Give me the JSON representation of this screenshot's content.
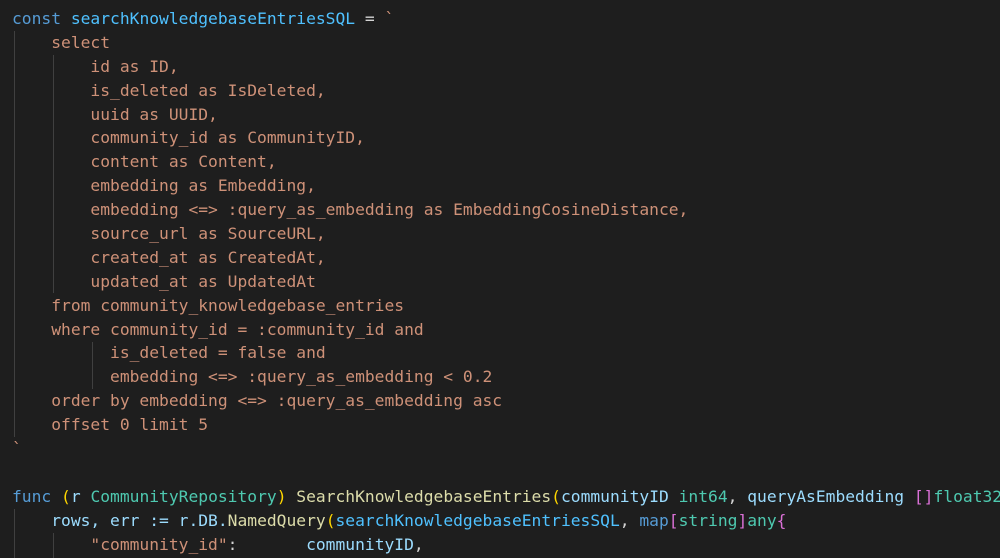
{
  "editor": {
    "code_lines": [
      [
        {
          "text": "const ",
          "cls": "kw"
        },
        {
          "text": "searchKnowledgebaseEntriesSQL",
          "cls": "ct"
        },
        {
          "text": " = ",
          "cls": "op"
        },
        {
          "text": "`",
          "cls": "str"
        }
      ],
      [
        {
          "text": "    select",
          "cls": "str"
        }
      ],
      [
        {
          "text": "        id as ID,",
          "cls": "str"
        }
      ],
      [
        {
          "text": "        is_deleted as IsDeleted,",
          "cls": "str"
        }
      ],
      [
        {
          "text": "        uuid as UUID,",
          "cls": "str"
        }
      ],
      [
        {
          "text": "        community_id as CommunityID,",
          "cls": "str"
        }
      ],
      [
        {
          "text": "        content as Content,",
          "cls": "str"
        }
      ],
      [
        {
          "text": "        embedding as Embedding,",
          "cls": "str"
        }
      ],
      [
        {
          "text": "        embedding <=> :query_as_embedding as EmbeddingCosineDistance,",
          "cls": "str"
        }
      ],
      [
        {
          "text": "        source_url as SourceURL,",
          "cls": "str"
        }
      ],
      [
        {
          "text": "        created_at as CreatedAt,",
          "cls": "str"
        }
      ],
      [
        {
          "text": "        updated_at as UpdatedAt",
          "cls": "str"
        }
      ],
      [
        {
          "text": "    from community_knowledgebase_entries",
          "cls": "str"
        }
      ],
      [
        {
          "text": "    where community_id = :community_id and",
          "cls": "str"
        }
      ],
      [
        {
          "text": "          is_deleted = false and",
          "cls": "str"
        }
      ],
      [
        {
          "text": "          embedding <=> :query_as_embedding < 0.2",
          "cls": "str"
        }
      ],
      [
        {
          "text": "    order by embedding <=> :query_as_embedding asc",
          "cls": "str"
        }
      ],
      [
        {
          "text": "    offset 0 limit 5",
          "cls": "str"
        }
      ],
      [
        {
          "text": "`",
          "cls": "str"
        }
      ],
      [
        {
          "text": "",
          "cls": "op"
        }
      ],
      [
        {
          "text": "func ",
          "cls": "kw"
        },
        {
          "text": "(",
          "cls": "br1"
        },
        {
          "text": "r ",
          "cls": "pm"
        },
        {
          "text": "CommunityRepository",
          "cls": "tp"
        },
        {
          "text": ") ",
          "cls": "br1"
        },
        {
          "text": "SearchKnowledgebaseEntries",
          "cls": "fn"
        },
        {
          "text": "(",
          "cls": "br1"
        },
        {
          "text": "communityID ",
          "cls": "pm"
        },
        {
          "text": "int64",
          "cls": "tp"
        },
        {
          "text": ", ",
          "cls": "op"
        },
        {
          "text": "queryAsEmbedding ",
          "cls": "pm"
        },
        {
          "text": "[]",
          "cls": "br2"
        },
        {
          "text": "float32",
          "cls": "tp"
        },
        {
          "text": ")",
          "cls": "br1"
        }
      ],
      [
        {
          "text": "    rows, err := ",
          "cls": "pm"
        },
        {
          "text": "r.DB.",
          "cls": "pm"
        },
        {
          "text": "NamedQuery",
          "cls": "fn"
        },
        {
          "text": "(",
          "cls": "br1"
        },
        {
          "text": "searchKnowledgebaseEntriesSQL",
          "cls": "ct"
        },
        {
          "text": ", ",
          "cls": "op"
        },
        {
          "text": "map",
          "cls": "kw"
        },
        {
          "text": "[",
          "cls": "br2"
        },
        {
          "text": "string",
          "cls": "tp"
        },
        {
          "text": "]",
          "cls": "br2"
        },
        {
          "text": "any",
          "cls": "tp"
        },
        {
          "text": "{",
          "cls": "br2"
        }
      ],
      [
        {
          "text": "        \"community_id\"",
          "cls": "str"
        },
        {
          "text": ":       ",
          "cls": "op"
        },
        {
          "text": "communityID",
          "cls": "pm"
        },
        {
          "text": ",",
          "cls": "op"
        }
      ]
    ]
  }
}
